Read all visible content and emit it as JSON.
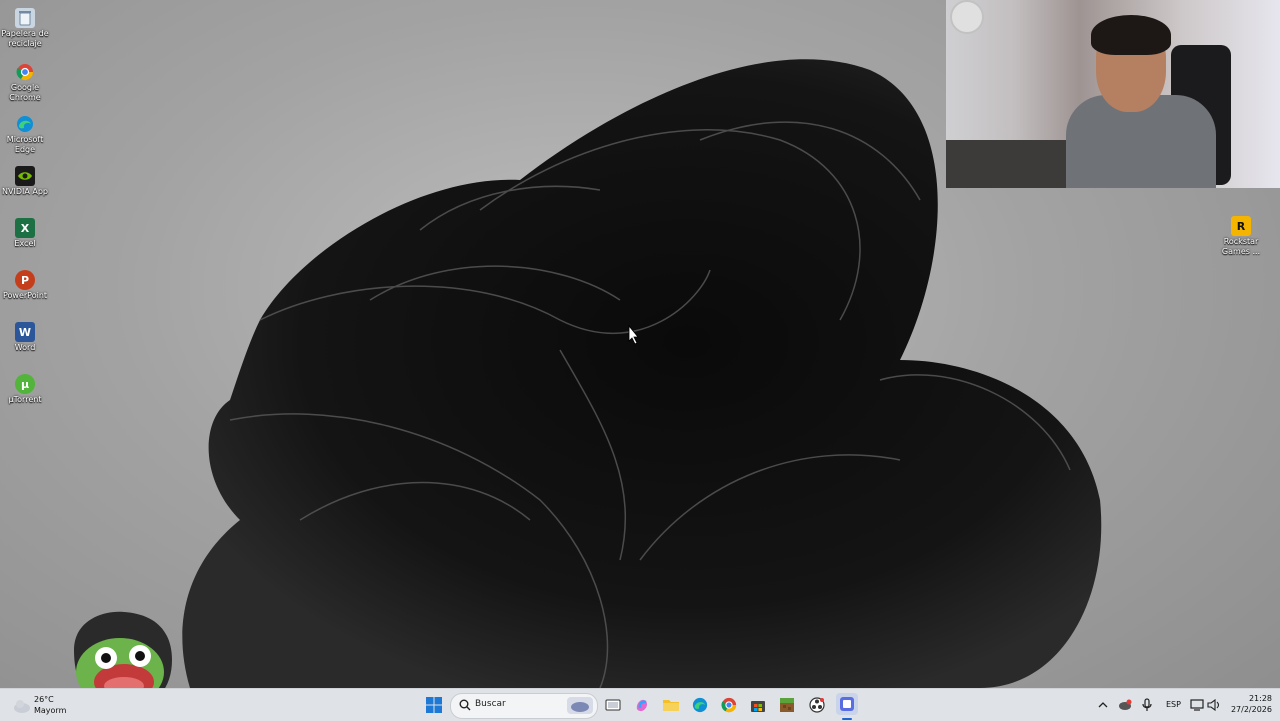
{
  "desktop_icons": [
    {
      "label": "Papelera de reciclaje",
      "icon": "recycle-bin-icon",
      "color": "#9fb6c9"
    },
    {
      "label": "Google Chrome",
      "icon": "chrome-icon",
      "color": "#db4437"
    },
    {
      "label": "Microsoft Edge",
      "icon": "edge-icon",
      "color": "#0f8fd6"
    },
    {
      "label": "NVIDIA App",
      "icon": "nvidia-icon",
      "color": "#76b900"
    },
    {
      "label": "Excel",
      "icon": "excel-icon",
      "color": "#1d7044"
    },
    {
      "label": "PowerPoint",
      "icon": "powerpoint-icon",
      "color": "#c43e1c"
    },
    {
      "label": "Word",
      "icon": "word-icon",
      "color": "#2b579a"
    },
    {
      "label": "µTorrent",
      "icon": "utorrent-icon",
      "color": "#52b43a"
    },
    {
      "label": "Rockstar Games ...",
      "icon": "rockstar-icon",
      "color": "#f4b400"
    }
  ],
  "taskbar": {
    "weather": {
      "temp": "26°C",
      "desc": "Mayorm",
      "icon": "weather-icon"
    },
    "search_placeholder": "Buscar",
    "apps": [
      {
        "name": "start",
        "icon": "windows-start-icon"
      },
      {
        "name": "task-view",
        "icon": "task-view-icon"
      },
      {
        "name": "copilot",
        "icon": "copilot-icon"
      },
      {
        "name": "file-explorer",
        "icon": "folder-icon"
      },
      {
        "name": "edge",
        "icon": "edge-icon"
      },
      {
        "name": "chrome",
        "icon": "chrome-icon"
      },
      {
        "name": "store",
        "icon": "store-icon"
      },
      {
        "name": "minecraft",
        "icon": "minecraft-icon"
      },
      {
        "name": "obs",
        "icon": "obs-icon"
      },
      {
        "name": "active-app",
        "icon": "app-window-icon"
      }
    ],
    "tray": {
      "language": "ESP",
      "time": "21:28",
      "date": "27/2/2026"
    }
  },
  "colors": {
    "taskbar_bg": "#dfe2e6",
    "accent": "#1e64d2"
  }
}
